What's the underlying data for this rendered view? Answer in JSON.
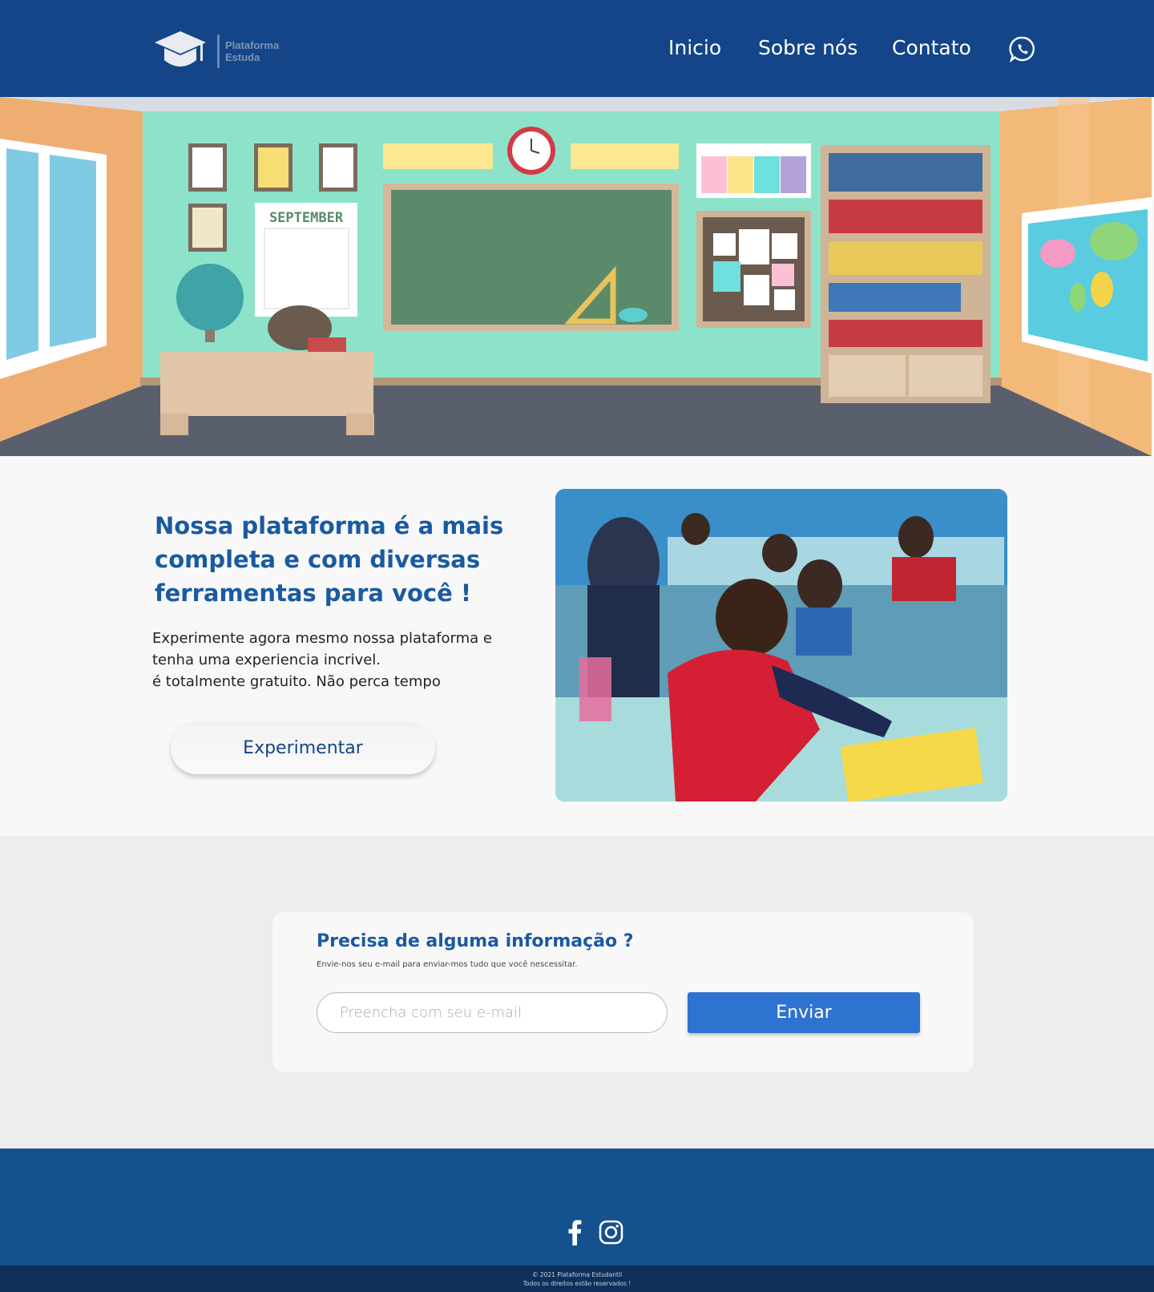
{
  "header": {
    "logo_line1": "Plataforma",
    "logo_line2": "Estuda",
    "nav": {
      "inicio": "Inicio",
      "sobre": "Sobre nós",
      "contato": "Contato"
    },
    "whatsapp_icon": "whatsapp-icon"
  },
  "hero": {
    "calendar_month": "SEPTEMBER"
  },
  "intro": {
    "title": "Nossa plataforma é a mais completa e com diversas ferramentas para você !",
    "text_line1": "Experimente agora mesmo nossa plataforma e",
    "text_line2": "tenha uma experiencia incrivel.",
    "text_line3": "é totalmente gratuito. Não perca tempo",
    "button": "Experimentar"
  },
  "newsletter": {
    "title": "Precisa de alguma informação ?",
    "subtitle": "Envie-nos seu e-mail para enviar-mos tudo que você nescessitar.",
    "placeholder": "Preencha com seu e-mail",
    "button": "Enviar"
  },
  "footer": {
    "icons": [
      "facebook-icon",
      "instagram-icon"
    ],
    "copyright_line1": "© 2021 Plataforma Estudantil",
    "copyright_line2": "Todos os direitos estão reservados !"
  },
  "colors": {
    "header_bg": "#134588",
    "accent_blue": "#1a5aa0",
    "button_blue": "#2f73d1",
    "footer_bg": "#15508f",
    "copyright_bg": "#0e2f5a"
  }
}
